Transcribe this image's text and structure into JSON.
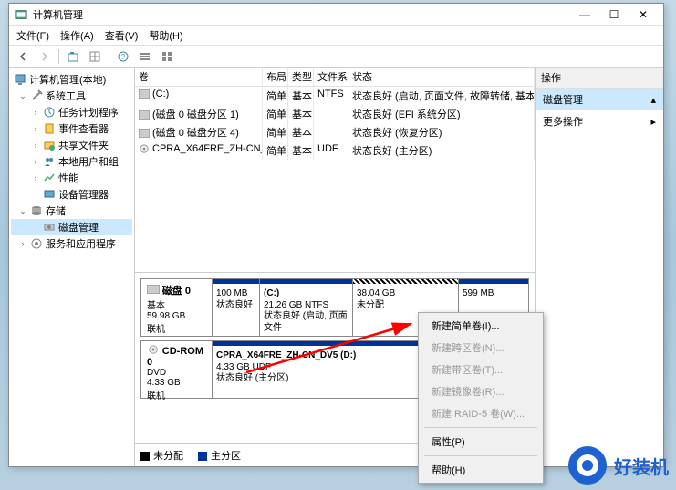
{
  "window": {
    "title": "计算机管理",
    "menus": [
      "文件(F)",
      "操作(A)",
      "查看(V)",
      "帮助(H)"
    ]
  },
  "tree": {
    "root": "计算机管理(本地)",
    "system_tools": "系统工具",
    "task_sched": "任务计划程序",
    "event_viewer": "事件查看器",
    "shared": "共享文件夹",
    "users": "本地用户和组",
    "perf": "性能",
    "devmgr": "设备管理器",
    "storage": "存储",
    "diskmgmt": "磁盘管理",
    "services": "服务和应用程序"
  },
  "vol_headers": {
    "vol": "卷",
    "layout": "布局",
    "type": "类型",
    "fs": "文件系统",
    "status": "状态"
  },
  "volumes": [
    {
      "name": "(C:)",
      "layout": "简单",
      "type": "基本",
      "fs": "NTFS",
      "status": "状态良好 (启动, 页面文件, 故障转储, 基本数据分..."
    },
    {
      "name": "(磁盘 0 磁盘分区 1)",
      "layout": "简单",
      "type": "基本",
      "fs": "",
      "status": "状态良好 (EFI 系统分区)"
    },
    {
      "name": "(磁盘 0 磁盘分区 4)",
      "layout": "简单",
      "type": "基本",
      "fs": "",
      "status": "状态良好 (恢复分区)"
    },
    {
      "name": "CPRA_X64FRE_ZH-CN_DV5 (D:)",
      "layout": "简单",
      "type": "基本",
      "fs": "UDF",
      "status": "状态良好 (主分区)"
    }
  ],
  "disk0": {
    "label": "磁盘 0",
    "type": "基本",
    "size": "59.98 GB",
    "state": "联机",
    "p1": {
      "size": "100 MB",
      "status": "状态良好"
    },
    "p2": {
      "name": "(C:)",
      "size": "21.26 GB NTFS",
      "status": "状态良好 (启动, 页面文件"
    },
    "p3": {
      "size": "38.04 GB",
      "status": "未分配"
    },
    "p4": {
      "size": "599 MB"
    }
  },
  "cdrom": {
    "label": "CD-ROM 0",
    "type": "DVD",
    "size": "4.33 GB",
    "state": "联机",
    "name": "CPRA_X64FRE_ZH-CN_DV5  (D:)",
    "detail": "4.33 GB UDF",
    "status": "状态良好 (主分区)"
  },
  "legend": {
    "unalloc": "未分配",
    "primary": "主分区"
  },
  "actions": {
    "header": "操作",
    "diskmgmt": "磁盘管理",
    "more": "更多操作"
  },
  "context_menu": [
    {
      "label": "新建简单卷(I)...",
      "enabled": true
    },
    {
      "label": "新建跨区卷(N)...",
      "enabled": false
    },
    {
      "label": "新建带区卷(T)...",
      "enabled": false
    },
    {
      "label": "新建镜像卷(R)...",
      "enabled": false
    },
    {
      "label": "新建 RAID-5 卷(W)...",
      "enabled": false
    },
    {
      "sep": true
    },
    {
      "label": "属性(P)",
      "enabled": true
    },
    {
      "sep": true
    },
    {
      "label": "帮助(H)",
      "enabled": true
    }
  ],
  "watermark": "好装机"
}
